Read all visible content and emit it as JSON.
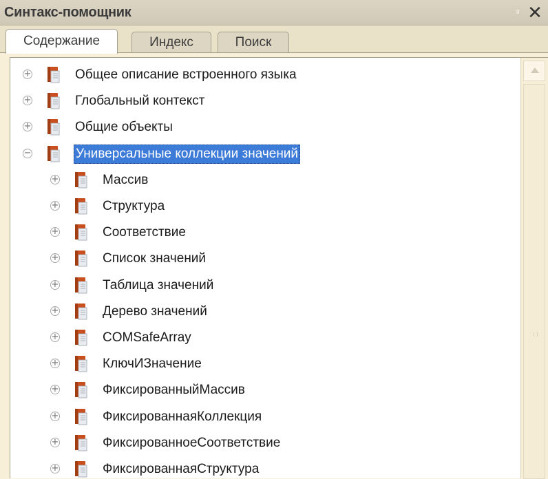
{
  "window": {
    "title": "Синтакс-помощник",
    "pin_glyph": "ᵍ",
    "close_glyph": "✕"
  },
  "tabs": [
    {
      "label": "Содержание",
      "active": true
    },
    {
      "label": "Индекс",
      "active": false
    },
    {
      "label": "Поиск",
      "active": false
    }
  ],
  "tree": {
    "items": [
      {
        "label": "Общее описание встроенного языка",
        "level": 0,
        "expanded": false,
        "selected": false
      },
      {
        "label": "Глобальный контекст",
        "level": 0,
        "expanded": false,
        "selected": false
      },
      {
        "label": "Общие объекты",
        "level": 0,
        "expanded": false,
        "selected": false
      },
      {
        "label": "Универсальные коллекции значений",
        "level": 0,
        "expanded": true,
        "selected": true
      },
      {
        "label": "Массив",
        "level": 1,
        "expanded": false,
        "selected": false
      },
      {
        "label": "Структура",
        "level": 1,
        "expanded": false,
        "selected": false
      },
      {
        "label": "Соответствие",
        "level": 1,
        "expanded": false,
        "selected": false
      },
      {
        "label": "Список значений",
        "level": 1,
        "expanded": false,
        "selected": false
      },
      {
        "label": "Таблица значений",
        "level": 1,
        "expanded": false,
        "selected": false
      },
      {
        "label": "Дерево значений",
        "level": 1,
        "expanded": false,
        "selected": false
      },
      {
        "label": "COMSafeArray",
        "level": 1,
        "expanded": false,
        "selected": false
      },
      {
        "label": "КлючИЗначение",
        "level": 1,
        "expanded": false,
        "selected": false
      },
      {
        "label": "ФиксированныйМассив",
        "level": 1,
        "expanded": false,
        "selected": false
      },
      {
        "label": "ФиксированнаяКоллекция",
        "level": 1,
        "expanded": false,
        "selected": false
      },
      {
        "label": "ФиксированноеСоответствие",
        "level": 1,
        "expanded": false,
        "selected": false
      },
      {
        "label": "ФиксированнаяСтруктура",
        "level": 1,
        "expanded": false,
        "selected": false
      }
    ],
    "toggle_glyphs": {
      "collapsed": "+",
      "expanded": "−"
    }
  },
  "colors": {
    "selection": "#3c7bd8",
    "book_cover": "#c9501e",
    "book_pages": "#e8ecf0",
    "panel_bg": "#f7efd7"
  },
  "icons": {
    "book": "book-icon",
    "expand": "expand-icon",
    "collapse": "collapse-icon",
    "close": "close-icon",
    "pin": "pin-icon"
  }
}
